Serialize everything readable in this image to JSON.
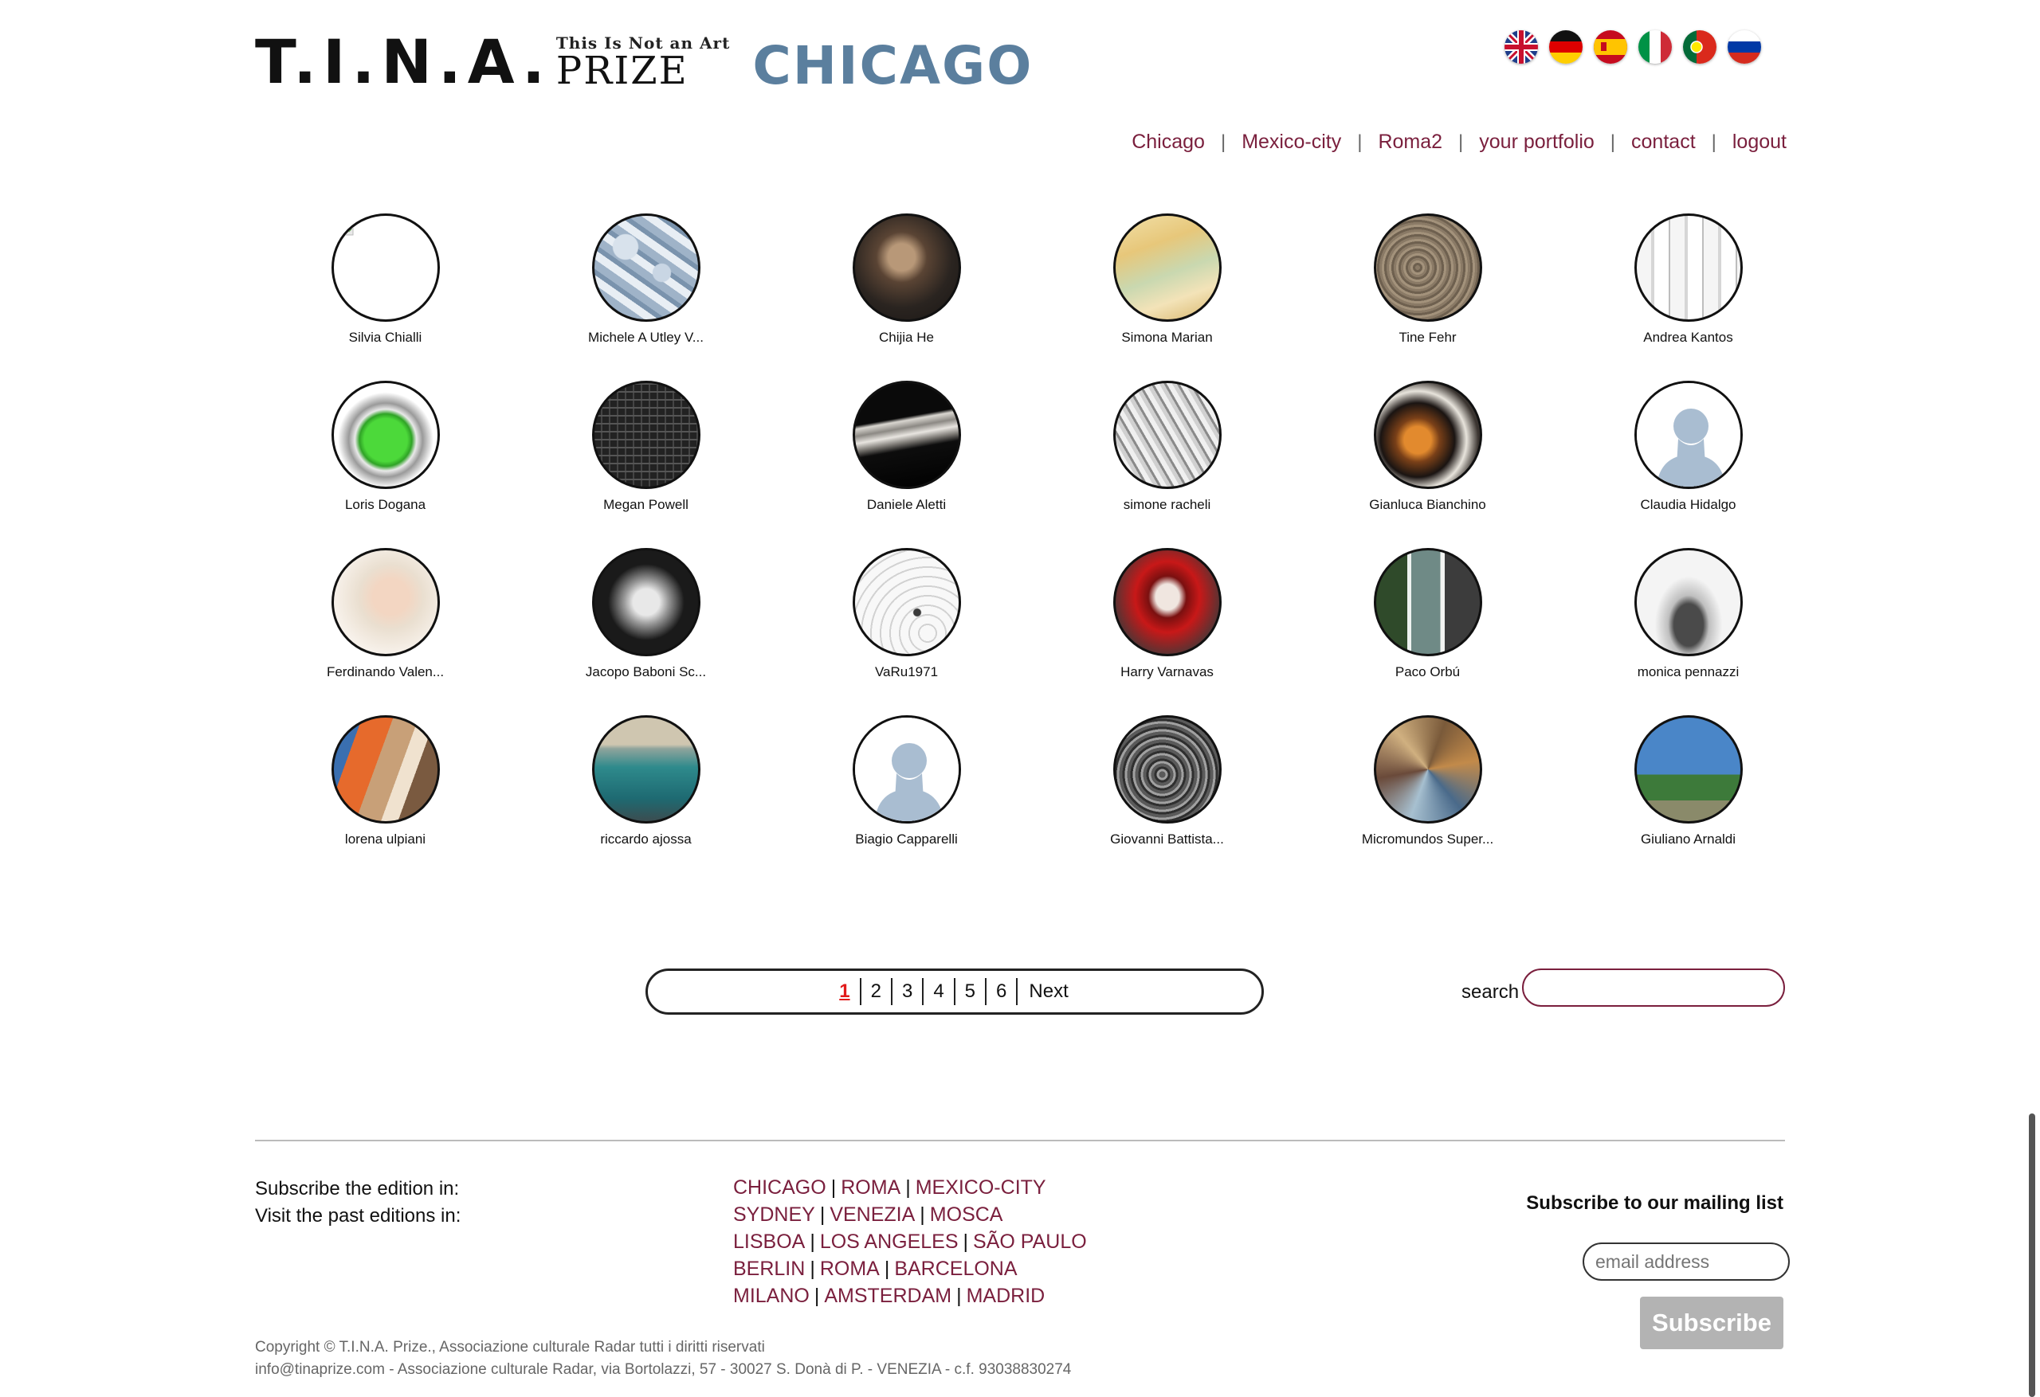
{
  "logo": {
    "tina": "T.I.N.A.",
    "tagline": "This Is Not an Art",
    "prize": "PRIZE",
    "city": "CHICAGO"
  },
  "flags": [
    {
      "name": "flag-uk-icon"
    },
    {
      "name": "flag-de-icon"
    },
    {
      "name": "flag-es-icon"
    },
    {
      "name": "flag-it-icon"
    },
    {
      "name": "flag-pt-icon"
    },
    {
      "name": "flag-ru-icon"
    }
  ],
  "nav": {
    "items": [
      "Chicago",
      "Mexico-city",
      "Roma2",
      "your portfolio",
      "contact",
      "logout"
    ],
    "separator": "|"
  },
  "artists": [
    {
      "name": "Silvia Chialli",
      "thumb": "broken-image"
    },
    {
      "name": "Michele A Utley V...",
      "thumb": "pills"
    },
    {
      "name": "Chijia He",
      "thumb": "portrait-dark"
    },
    {
      "name": "Simona Marian",
      "thumb": "yellow-abstract"
    },
    {
      "name": "Tine Fehr",
      "thumb": "ground-texture"
    },
    {
      "name": "Andrea Kantos",
      "thumb": "white-panels"
    },
    {
      "name": "Loris Dogana",
      "thumb": "green-sculpture"
    },
    {
      "name": "Megan Powell",
      "thumb": "dark-pattern"
    },
    {
      "name": "Daniele Aletti",
      "thumb": "rope"
    },
    {
      "name": "simone racheli",
      "thumb": "gray-sketch"
    },
    {
      "name": "Gianluca Bianchino",
      "thumb": "orange-lens"
    },
    {
      "name": "Claudia Hidalgo",
      "thumb": "default-avatar"
    },
    {
      "name": "Ferdinando Valen...",
      "thumb": "pale-portrait"
    },
    {
      "name": "Jacopo Baboni Sc...",
      "thumb": "bw-torso"
    },
    {
      "name": "VaRu1971",
      "thumb": "white-curves"
    },
    {
      "name": "Harry Varnavas",
      "thumb": "red-figure"
    },
    {
      "name": "Paco Orbú",
      "thumb": "windows"
    },
    {
      "name": "monica pennazzi",
      "thumb": "glass-disc"
    },
    {
      "name": "lorena ulpiani",
      "thumb": "colored-stripes"
    },
    {
      "name": "riccardo ajossa",
      "thumb": "teal-landscape"
    },
    {
      "name": "Biagio Capparelli",
      "thumb": "default-avatar"
    },
    {
      "name": "Giovanni Battista...",
      "thumb": "gray-relief"
    },
    {
      "name": "Micromundos Super...",
      "thumb": "multicolor-collage"
    },
    {
      "name": "Giuliano Arnaldi",
      "thumb": "blue-sky-sculpture"
    }
  ],
  "pagination": {
    "pages": [
      "1",
      "2",
      "3",
      "4",
      "5",
      "6"
    ],
    "current": "1",
    "next": "Next"
  },
  "search": {
    "label": "search",
    "value": "",
    "placeholder": ""
  },
  "footer": {
    "subscribe_label": "Subscribe the edition in:",
    "visit_label": "Visit the past editions in:",
    "edition_rows": [
      [
        "CHICAGO",
        "ROMA",
        "MEXICO-CITY"
      ],
      [
        "SYDNEY",
        "VENEZIA",
        "MOSCA"
      ],
      [
        "LISBOA",
        "LOS ANGELES",
        "SÃO PAULO"
      ],
      [
        "BERLIN",
        "ROMA",
        "BARCELONA"
      ],
      [
        "MILANO",
        "AMSTERDAM",
        "MADRID"
      ]
    ],
    "mailing_title": "Subscribe to our mailing list",
    "email_placeholder": "email address",
    "subscribe_button": "Subscribe",
    "copyright": "Copyright © T.I.N.A. Prize., Associazione culturale Radar tutti i diritti riservati",
    "address": "info@tinaprize.com - Associazione culturale Radar, via Bortolazzi, 57 - 30027 S. Donà di P. - VENEZIA - c.f. 93038830274"
  },
  "colors": {
    "accent": "#7a1f3d",
    "logo_city": "#5b7f9e",
    "active_page": "#e21a1a",
    "button_gray": "#b3b3b3"
  }
}
